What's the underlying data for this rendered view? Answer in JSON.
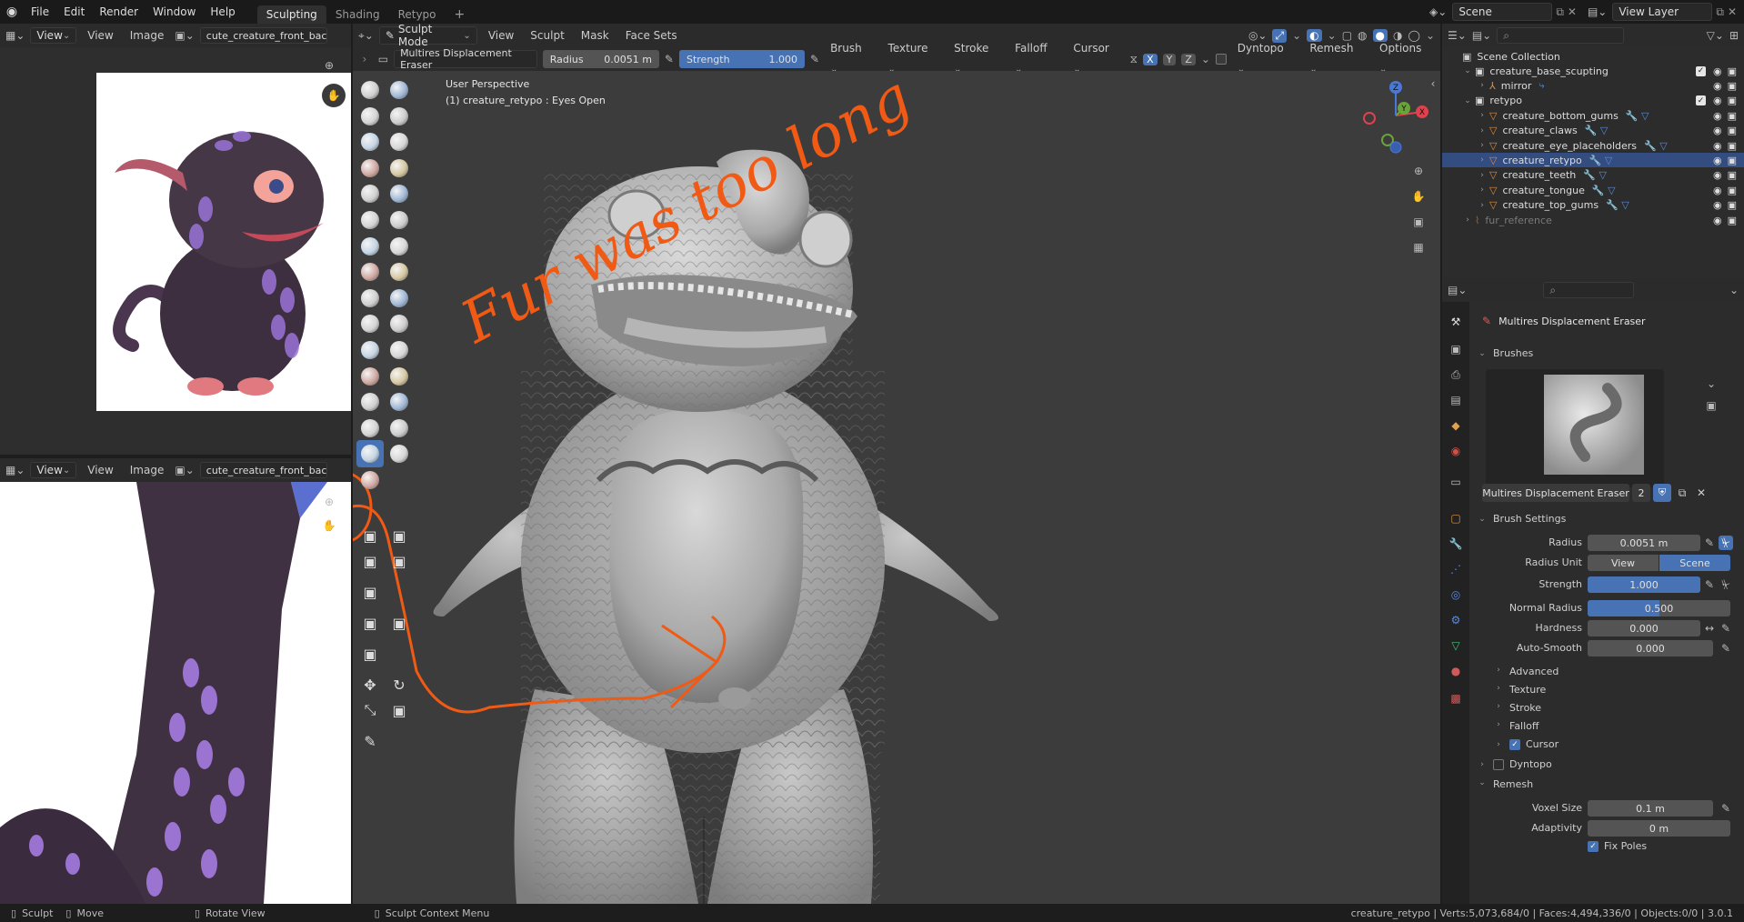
{
  "topbar": {
    "menus": [
      "File",
      "Edit",
      "Render",
      "Window",
      "Help"
    ],
    "workspaces": [
      "Sculpting",
      "Shading",
      "Retypo"
    ],
    "active_workspace": "Sculpting",
    "add_tab": "+",
    "scene": "Scene",
    "view_layer": "View Layer"
  },
  "image_editor_top": {
    "view": "View",
    "menu_view": "View",
    "menu_image": "Image",
    "image_name": "cute_creature_front_back."
  },
  "image_editor_bottom": {
    "view": "View",
    "menu_view": "View",
    "menu_image": "Image",
    "image_name": "cute_creature_front_back."
  },
  "viewport_header": {
    "mode": "Sculpt Mode",
    "menus": [
      "View",
      "Sculpt",
      "Mask",
      "Face Sets"
    ]
  },
  "tool_header": {
    "brush_name": "Multires Displacement Eraser",
    "radius_label": "Radius",
    "radius_value": "0.0051 m",
    "strength_label": "Strength",
    "strength_value": "1.000",
    "strength_fraction": 1.0,
    "menus": [
      "Brush",
      "Texture",
      "Stroke",
      "Falloff",
      "Cursor"
    ],
    "axes": [
      "X",
      "Y",
      "Z"
    ],
    "dyntopo": "Dyntopo",
    "remesh": "Remesh",
    "options": "Options"
  },
  "viewport": {
    "perspective": "User Perspective",
    "object_info": "(1) creature_retypo : Eyes Open",
    "annotation": "Fur was too long"
  },
  "gizmo": {
    "x": "X",
    "y": "Y",
    "z": "Z"
  },
  "outliner": {
    "search_placeholder": "",
    "collection": "Scene Collection",
    "rows": [
      {
        "name": "creature_base_scupting",
        "depth": 1,
        "type": "collection"
      },
      {
        "name": "mirror",
        "depth": 2,
        "type": "empty"
      },
      {
        "name": "retypo",
        "depth": 1,
        "type": "collection"
      },
      {
        "name": "creature_bottom_gums",
        "depth": 2,
        "type": "mesh"
      },
      {
        "name": "creature_claws",
        "depth": 2,
        "type": "mesh"
      },
      {
        "name": "creature_eye_placeholders",
        "depth": 2,
        "type": "mesh"
      },
      {
        "name": "creature_retypo",
        "depth": 2,
        "type": "mesh"
      },
      {
        "name": "creature_teeth",
        "depth": 2,
        "type": "mesh"
      },
      {
        "name": "creature_tongue",
        "depth": 2,
        "type": "mesh"
      },
      {
        "name": "creature_top_gums",
        "depth": 2,
        "type": "mesh"
      },
      {
        "name": "fur_reference",
        "depth": 1,
        "type": "curves"
      }
    ]
  },
  "properties": {
    "brush_title": "Multires Displacement Eraser",
    "brushes_section": "Brushes",
    "brush_field_name": "Multires Displacement Eraser",
    "brush_users": "2",
    "brush_settings_section": "Brush Settings",
    "radius_label": "Radius",
    "radius_value": "0.0051 m",
    "radius_unit_label": "Radius Unit",
    "radius_unit_view": "View",
    "radius_unit_scene": "Scene",
    "strength_label": "Strength",
    "strength_value": "1.000",
    "strength_fraction": 1.0,
    "normal_radius_label": "Normal Radius",
    "normal_radius_value": "0.500",
    "normal_radius_fraction": 0.5,
    "hardness_label": "Hardness",
    "hardness_value": "0.000",
    "autosmooth_label": "Auto-Smooth",
    "autosmooth_value": "0.000",
    "subpanels": [
      "Advanced",
      "Texture",
      "Stroke",
      "Falloff"
    ],
    "cursor_label": "Cursor",
    "dyntopo_label": "Dyntopo",
    "remesh_section": "Remesh",
    "voxel_size_label": "Voxel Size",
    "voxel_size_value": "0.1 m",
    "adaptivity_label": "Adaptivity",
    "adaptivity_value": "0 m",
    "fix_poles_label": "Fix Poles"
  },
  "statusbar": {
    "left_items": [
      "Sculpt",
      "Move",
      "Rotate View",
      "Sculpt Context Menu"
    ],
    "right": "creature_retypo | Verts:5,073,684/0 | Faces:4,494,336/0 | Objects:0/0 | 3.0.1"
  },
  "colors": {
    "accent": "#4772b3",
    "annotation": "#f05a14",
    "header": "#2b2b2b",
    "viewport": "#3c3c3c"
  }
}
